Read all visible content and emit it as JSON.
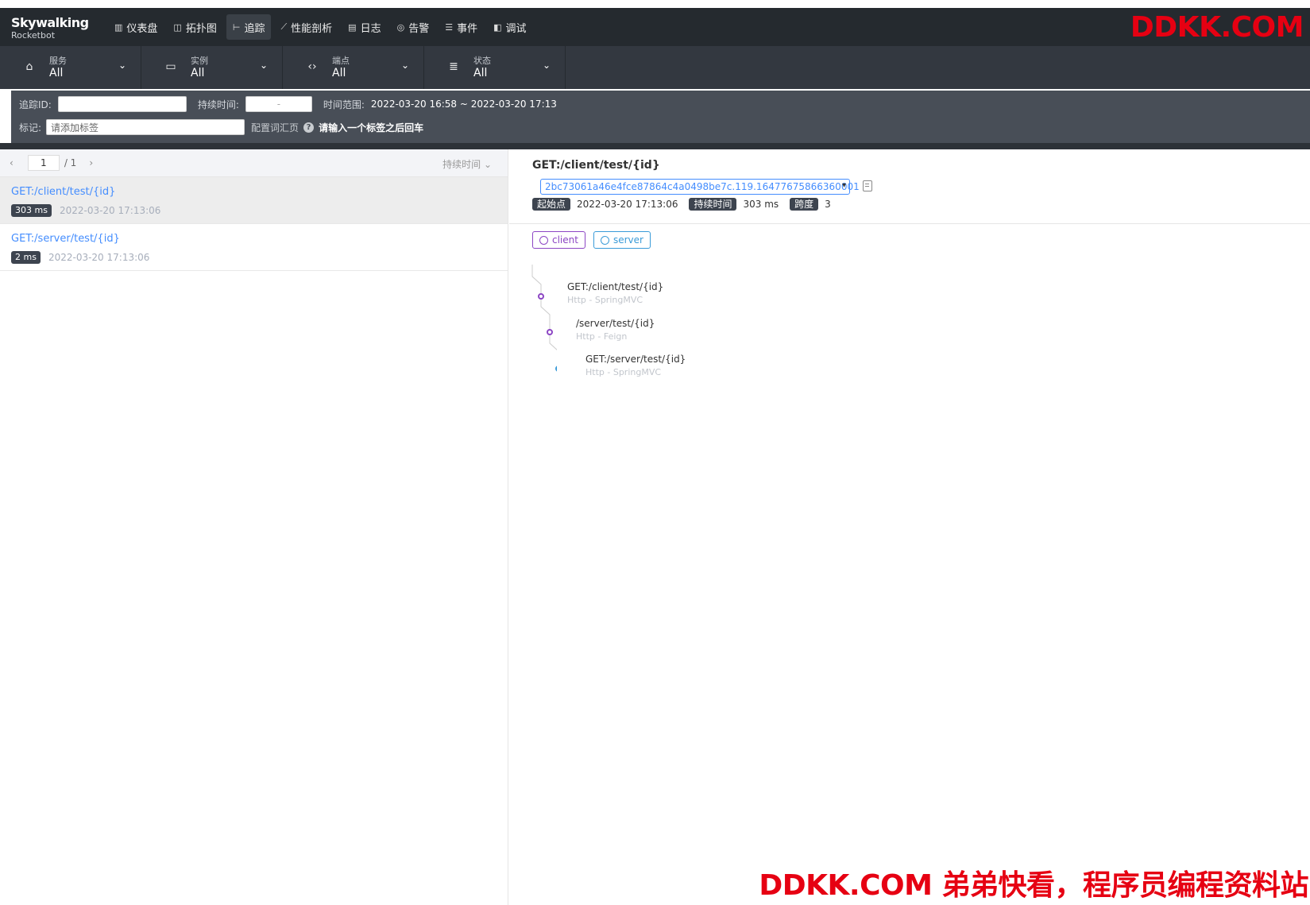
{
  "app": {
    "logo_line1": "Skywalking",
    "logo_line2": "Rocketbot"
  },
  "nav": [
    {
      "label": "仪表盘",
      "icon": "dashboard-icon"
    },
    {
      "label": "拓扑图",
      "icon": "topology-icon"
    },
    {
      "label": "追踪",
      "icon": "trace-icon",
      "active": true
    },
    {
      "label": "性能剖析",
      "icon": "profile-icon"
    },
    {
      "label": "日志",
      "icon": "log-icon"
    },
    {
      "label": "告警",
      "icon": "alarm-icon"
    },
    {
      "label": "事件",
      "icon": "event-icon"
    },
    {
      "label": "调试",
      "icon": "debug-icon"
    }
  ],
  "watermark": {
    "top": "DDKK.COM",
    "bottom": "DDKK.COM 弟弟快看，程序员编程资料站"
  },
  "filters": [
    {
      "label": "服务",
      "value": "All",
      "icon": "service-icon"
    },
    {
      "label": "实例",
      "value": "All",
      "icon": "instance-icon"
    },
    {
      "label": "端点",
      "value": "All",
      "icon": "endpoint-icon"
    },
    {
      "label": "状态",
      "value": "All",
      "icon": "status-icon"
    }
  ],
  "search": {
    "trace_id_label": "追踪ID:",
    "trace_id_value": "",
    "duration_label": "持续时间:",
    "duration_value": "-",
    "time_range_label": "时间范围:",
    "time_range_value": "2022-03-20 16:58 ~ 2022-03-20 17:13",
    "tags_label": "标记:",
    "tags_placeholder": "请添加标签",
    "vocab_link": "配置词汇页",
    "hint": "请输入一个标签之后回车"
  },
  "list": {
    "page": "1",
    "total": "/ 1",
    "sort_label": "持续时间",
    "items": [
      {
        "name": "GET:/client/test/{id}",
        "duration": "303 ms",
        "time": "2022-03-20 17:13:06"
      },
      {
        "name": "GET:/server/test/{id}",
        "duration": "2 ms",
        "time": "2022-03-20 17:13:06"
      }
    ]
  },
  "detail": {
    "title": "GET:/client/test/{id}",
    "trace_id": "2bc73061a46e4fce87864c4a0498be7c.119.16477675866360001",
    "start_label": "起始点",
    "start_value": "2022-03-20 17:13:06",
    "duration_label": "持续时间",
    "duration_value": "303 ms",
    "span_label": "跨度",
    "span_value": "3",
    "legend": [
      {
        "name": "client",
        "color": "#8c46c4"
      },
      {
        "name": "server",
        "color": "#3a9bd8"
      }
    ],
    "spans": [
      {
        "name": "GET:/client/test/{id}",
        "type": "Http - SpringMVC",
        "depth": 0,
        "service": "client"
      },
      {
        "name": "/server/test/{id}",
        "type": "Http - Feign",
        "depth": 1,
        "service": "client"
      },
      {
        "name": "GET:/server/test/{id}",
        "type": "Http - SpringMVC",
        "depth": 2,
        "service": "server"
      }
    ]
  }
}
